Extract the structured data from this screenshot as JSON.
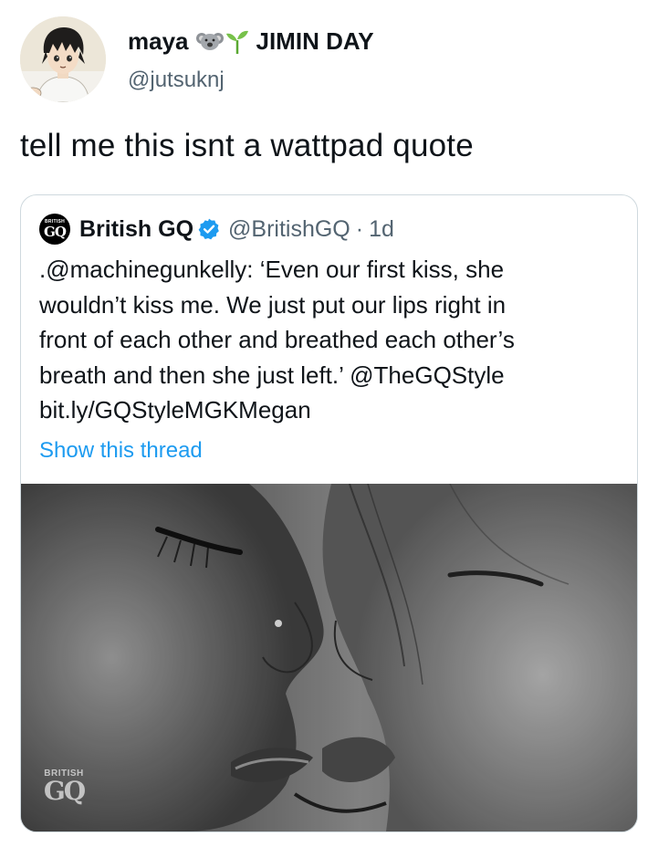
{
  "author": {
    "display_name": "maya",
    "name_suffix": "JIMIN DAY",
    "handle": "@jutsuknj",
    "avatar_icon": "anime-character-avatar",
    "name_emojis": [
      "koala-emoji",
      "seedling-emoji"
    ]
  },
  "tweet": {
    "text": "tell me this isnt a wattpad quote"
  },
  "quoted_tweet": {
    "name": "British GQ",
    "handle": "@BritishGQ",
    "separator": "·",
    "time": "1d",
    "verified": true,
    "avatar_icon": "british-gq-logo",
    "avatar_label_top": "BRITISH",
    "avatar_label_main": "GQ",
    "body_lines": [
      ".@machinegunkelly: ‘Even our first kiss, she",
      "wouldn’t kiss me. We just put our lips right in",
      "front of each other and breathed each other’s",
      "breath and then she just left.’ @TheGQStyle",
      "bit.ly/GQStyleMGKMegan"
    ],
    "show_thread": "Show this thread",
    "media": {
      "description_icon": "black-and-white-photo",
      "watermark_top": "BRITISH",
      "watermark_main": "GQ"
    }
  },
  "colors": {
    "text_primary": "#0f1419",
    "text_secondary": "#536471",
    "link_blue": "#1d9bf0",
    "border": "#cfd9de",
    "verified_blue": "#1d9bf0"
  }
}
